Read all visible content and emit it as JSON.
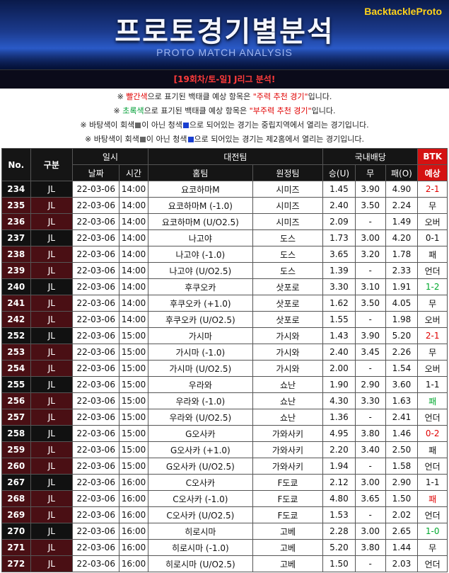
{
  "banner": {
    "title": "프로토경기별분석",
    "subtitle": "PROTO MATCH ANALYSIS",
    "logo": "BacktackleProto"
  },
  "round_title": "[19회차/토-일] J리그 분석!",
  "notes": [
    {
      "parts": [
        {
          "t": "※ ",
          "c": ""
        },
        {
          "t": "빨간색",
          "c": "red"
        },
        {
          "t": "으로 표기된 백태클 예상 항목은 ",
          "c": ""
        },
        {
          "t": "\"주력 추천 경기\"",
          "c": "red"
        },
        {
          "t": "입니다.",
          "c": ""
        }
      ]
    },
    {
      "parts": [
        {
          "t": "※ ",
          "c": ""
        },
        {
          "t": "초록색",
          "c": "green"
        },
        {
          "t": "으로 표기된 백태클 예상 항목은 ",
          "c": ""
        },
        {
          "t": "\"부주력 추천 경기\"",
          "c": "red"
        },
        {
          "t": "입니다.",
          "c": ""
        }
      ]
    },
    {
      "parts": [
        {
          "t": "※ 바탕색이 회색",
          "c": ""
        },
        {
          "t": "■",
          "c": "sq-gray"
        },
        {
          "t": "이 아닌 청색",
          "c": ""
        },
        {
          "t": "■",
          "c": "sq-blue"
        },
        {
          "t": "으로 되어있는 경기는 중립지역에서 열리는 경기입니다.",
          "c": ""
        }
      ]
    },
    {
      "parts": [
        {
          "t": "※ 바탕색이 회색",
          "c": ""
        },
        {
          "t": "■",
          "c": "sq-gray"
        },
        {
          "t": "이 아닌 청색",
          "c": ""
        },
        {
          "t": "■",
          "c": "sq-blue"
        },
        {
          "t": "으로 되어있는 경기는 제2홈에서 열리는 경기입니다.",
          "c": ""
        }
      ]
    }
  ],
  "table": {
    "headers": {
      "no": "No.",
      "gubun": "구분",
      "ilsi": "일시",
      "daejeon": "대전팀",
      "baedang": "국내배당",
      "btk": "BTK",
      "date": "날짜",
      "time": "시간",
      "home": "홈팀",
      "away": "원정팀",
      "win": "승(U)",
      "draw": "무",
      "lose": "패(O)",
      "pred": "예상"
    },
    "rows": [
      {
        "no": "234",
        "lg": "JL",
        "date": "22-03-06",
        "time": "14:00",
        "home": "요코하마M",
        "away": "시미즈",
        "w": "1.45",
        "d": "3.90",
        "l": "4.90",
        "pred": "2-1",
        "pc": "red",
        "shade": "black"
      },
      {
        "no": "235",
        "lg": "JL",
        "date": "22-03-06",
        "time": "14:00",
        "home": "요코하마M (-1.0)",
        "away": "시미즈",
        "w": "2.40",
        "d": "3.50",
        "l": "2.24",
        "pred": "무",
        "pc": "",
        "shade": "maroon"
      },
      {
        "no": "236",
        "lg": "JL",
        "date": "22-03-06",
        "time": "14:00",
        "home": "요코하마M (U/O2.5)",
        "away": "시미즈",
        "w": "2.09",
        "d": "-",
        "l": "1.49",
        "pred": "오버",
        "pc": "",
        "shade": "maroon"
      },
      {
        "no": "237",
        "lg": "JL",
        "date": "22-03-06",
        "time": "14:00",
        "home": "나고야",
        "away": "도스",
        "w": "1.73",
        "d": "3.00",
        "l": "4.20",
        "pred": "0-1",
        "pc": "",
        "shade": "black"
      },
      {
        "no": "238",
        "lg": "JL",
        "date": "22-03-06",
        "time": "14:00",
        "home": "나고야 (-1.0)",
        "away": "도스",
        "w": "3.65",
        "d": "3.20",
        "l": "1.78",
        "pred": "패",
        "pc": "",
        "shade": "maroon"
      },
      {
        "no": "239",
        "lg": "JL",
        "date": "22-03-06",
        "time": "14:00",
        "home": "나고야 (U/O2.5)",
        "away": "도스",
        "w": "1.39",
        "d": "-",
        "l": "2.33",
        "pred": "언더",
        "pc": "",
        "shade": "maroon"
      },
      {
        "no": "240",
        "lg": "JL",
        "date": "22-03-06",
        "time": "14:00",
        "home": "후쿠오카",
        "away": "삿포로",
        "w": "3.30",
        "d": "3.10",
        "l": "1.91",
        "pred": "1-2",
        "pc": "green",
        "shade": "black"
      },
      {
        "no": "241",
        "lg": "JL",
        "date": "22-03-06",
        "time": "14:00",
        "home": "후쿠오카 (+1.0)",
        "away": "삿포로",
        "w": "1.62",
        "d": "3.50",
        "l": "4.05",
        "pred": "무",
        "pc": "",
        "shade": "maroon"
      },
      {
        "no": "242",
        "lg": "JL",
        "date": "22-03-06",
        "time": "14:00",
        "home": "후쿠오카 (U/O2.5)",
        "away": "삿포로",
        "w": "1.55",
        "d": "-",
        "l": "1.98",
        "pred": "오버",
        "pc": "",
        "shade": "maroon"
      },
      {
        "no": "252",
        "lg": "JL",
        "date": "22-03-06",
        "time": "15:00",
        "home": "가시마",
        "away": "가시와",
        "w": "1.43",
        "d": "3.90",
        "l": "5.20",
        "pred": "2-1",
        "pc": "red",
        "shade": "black"
      },
      {
        "no": "253",
        "lg": "JL",
        "date": "22-03-06",
        "time": "15:00",
        "home": "가시마 (-1.0)",
        "away": "가시와",
        "w": "2.40",
        "d": "3.45",
        "l": "2.26",
        "pred": "무",
        "pc": "",
        "shade": "maroon"
      },
      {
        "no": "254",
        "lg": "JL",
        "date": "22-03-06",
        "time": "15:00",
        "home": "가시마 (U/O2.5)",
        "away": "가시와",
        "w": "2.00",
        "d": "-",
        "l": "1.54",
        "pred": "오버",
        "pc": "",
        "shade": "maroon"
      },
      {
        "no": "255",
        "lg": "JL",
        "date": "22-03-06",
        "time": "15:00",
        "home": "우라와",
        "away": "쇼난",
        "w": "1.90",
        "d": "2.90",
        "l": "3.60",
        "pred": "1-1",
        "pc": "",
        "shade": "black"
      },
      {
        "no": "256",
        "lg": "JL",
        "date": "22-03-06",
        "time": "15:00",
        "home": "우라와 (-1.0)",
        "away": "쇼난",
        "w": "4.30",
        "d": "3.30",
        "l": "1.63",
        "pred": "패",
        "pc": "green",
        "shade": "maroon"
      },
      {
        "no": "257",
        "lg": "JL",
        "date": "22-03-06",
        "time": "15:00",
        "home": "우라와 (U/O2.5)",
        "away": "쇼난",
        "w": "1.36",
        "d": "-",
        "l": "2.41",
        "pred": "언더",
        "pc": "",
        "shade": "maroon"
      },
      {
        "no": "258",
        "lg": "JL",
        "date": "22-03-06",
        "time": "15:00",
        "home": "G오사카",
        "away": "가와사키",
        "w": "4.95",
        "d": "3.80",
        "l": "1.46",
        "pred": "0-2",
        "pc": "red",
        "shade": "black"
      },
      {
        "no": "259",
        "lg": "JL",
        "date": "22-03-06",
        "time": "15:00",
        "home": "G오사카 (+1.0)",
        "away": "가와사키",
        "w": "2.20",
        "d": "3.40",
        "l": "2.50",
        "pred": "패",
        "pc": "",
        "shade": "maroon"
      },
      {
        "no": "260",
        "lg": "JL",
        "date": "22-03-06",
        "time": "15:00",
        "home": "G오사카 (U/O2.5)",
        "away": "가와사키",
        "w": "1.94",
        "d": "-",
        "l": "1.58",
        "pred": "언더",
        "pc": "",
        "shade": "maroon"
      },
      {
        "no": "267",
        "lg": "JL",
        "date": "22-03-06",
        "time": "16:00",
        "home": "C오사카",
        "away": "F도쿄",
        "w": "2.12",
        "d": "3.00",
        "l": "2.90",
        "pred": "1-1",
        "pc": "",
        "shade": "black"
      },
      {
        "no": "268",
        "lg": "JL",
        "date": "22-03-06",
        "time": "16:00",
        "home": "C오사카 (-1.0)",
        "away": "F도쿄",
        "w": "4.80",
        "d": "3.65",
        "l": "1.50",
        "pred": "패",
        "pc": "red",
        "shade": "maroon"
      },
      {
        "no": "269",
        "lg": "JL",
        "date": "22-03-06",
        "time": "16:00",
        "home": "C오사카 (U/O2.5)",
        "away": "F도쿄",
        "w": "1.53",
        "d": "-",
        "l": "2.02",
        "pred": "언더",
        "pc": "",
        "shade": "maroon"
      },
      {
        "no": "270",
        "lg": "JL",
        "date": "22-03-06",
        "time": "16:00",
        "home": "히로시마",
        "away": "고베",
        "w": "2.28",
        "d": "3.00",
        "l": "2.65",
        "pred": "1-0",
        "pc": "green",
        "shade": "black"
      },
      {
        "no": "271",
        "lg": "JL",
        "date": "22-03-06",
        "time": "16:00",
        "home": "히로시마 (-1.0)",
        "away": "고베",
        "w": "5.20",
        "d": "3.80",
        "l": "1.44",
        "pred": "무",
        "pc": "",
        "shade": "maroon"
      },
      {
        "no": "272",
        "lg": "JL",
        "date": "22-03-06",
        "time": "16:00",
        "home": "히로시마 (U/O2.5)",
        "away": "고베",
        "w": "1.50",
        "d": "-",
        "l": "2.03",
        "pred": "언더",
        "pc": "",
        "shade": "maroon"
      }
    ]
  }
}
